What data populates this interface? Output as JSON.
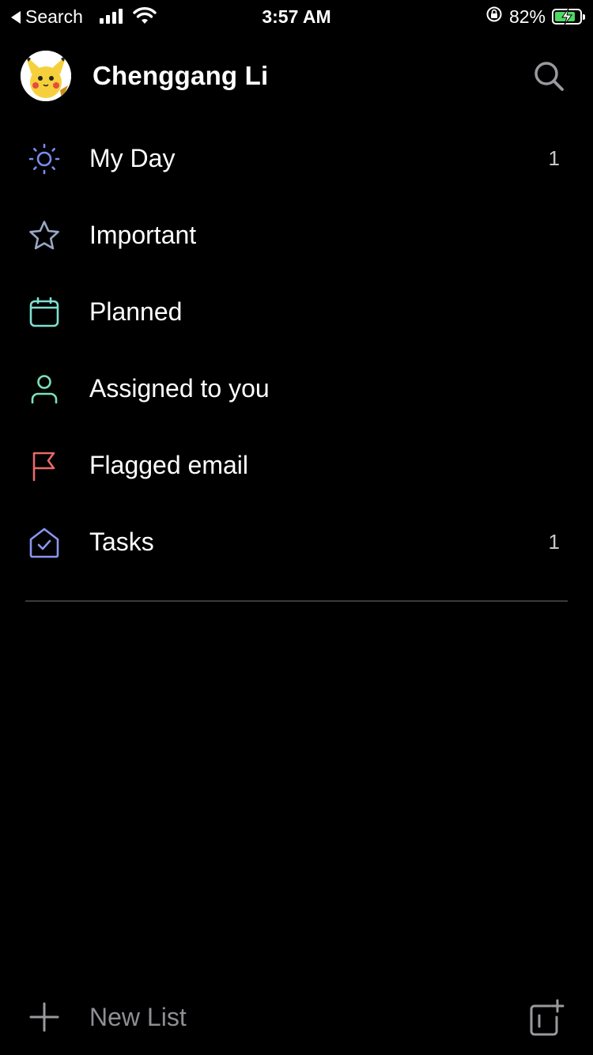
{
  "status_bar": {
    "back_label": "Search",
    "time": "3:57 AM",
    "battery_percent": "82%",
    "battery_level": 0.82,
    "battery_color": "#4cd964"
  },
  "header": {
    "user_name": "Chenggang Li",
    "avatar_icon": "pikachu-avatar",
    "search_icon": "search-icon"
  },
  "lists": [
    {
      "label": "My Day",
      "count": "1",
      "icon": "sun-icon",
      "icon_color": "#7a8cf0"
    },
    {
      "label": "Important",
      "count": "",
      "icon": "star-icon",
      "icon_color": "#9aa8c4"
    },
    {
      "label": "Planned",
      "count": "",
      "icon": "calendar-icon",
      "icon_color": "#7ee0d0"
    },
    {
      "label": "Assigned to you",
      "count": "",
      "icon": "person-icon",
      "icon_color": "#7ee0b8"
    },
    {
      "label": "Flagged email",
      "count": "",
      "icon": "flag-icon",
      "icon_color": "#e86a6a"
    },
    {
      "label": "Tasks",
      "count": "1",
      "icon": "home-check-icon",
      "icon_color": "#8a96f0"
    }
  ],
  "footer": {
    "new_list_label": "New List",
    "new_list_icon": "plus-icon",
    "new_group_icon": "new-group-icon"
  }
}
